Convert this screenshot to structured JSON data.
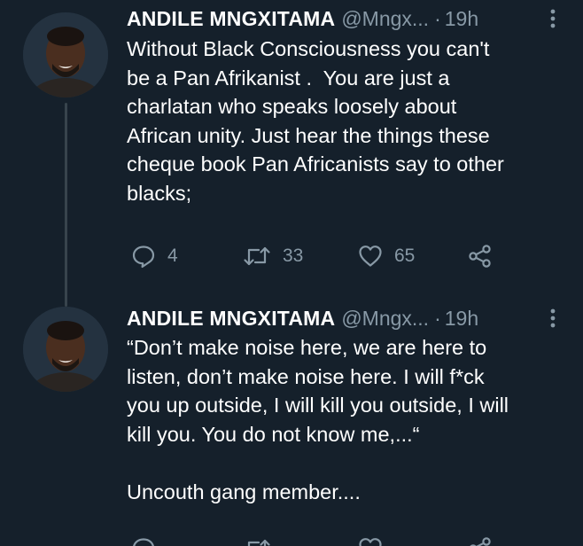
{
  "tweets": [
    {
      "author_name": "ANDILE MNGXITAMA",
      "handle": "@Mngx...",
      "separator": "·",
      "time": "19h",
      "text_lines": [
        "Without Black Consciousness you can't",
        "be a Pan Afrikanist .  You are just a",
        "charlatan who speaks loosely about",
        "African unity. Just hear the things these",
        "cheque book Pan Africanists say to other",
        "blacks;"
      ],
      "replies": "4",
      "retweets": "33",
      "likes": "65",
      "icons": [
        "more-vertical-icon",
        "reply-icon",
        "retweet-icon",
        "heart-icon",
        "share-icon"
      ]
    },
    {
      "author_name": "ANDILE MNGXITAMA",
      "handle": "@Mngx...",
      "separator": "·",
      "time": "19h",
      "text_lines": [
        "“Don’t make noise here, we are here to",
        "listen, don’t make noise here. I will f*ck",
        "you up outside, I will kill you outside, I will",
        "kill you. You do not know me,...“",
        "",
        "Uncouth gang member...."
      ]
    }
  ],
  "colors": {
    "background": "#15202b",
    "text": "#ffffff",
    "secondary": "#8899a6",
    "thread_line": "#38444d"
  }
}
